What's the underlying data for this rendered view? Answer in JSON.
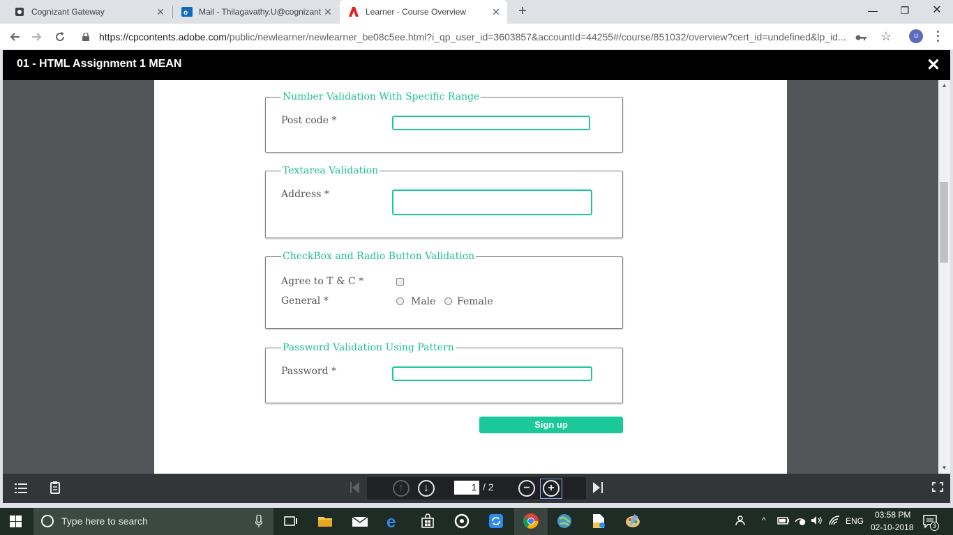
{
  "browser": {
    "tabs": [
      {
        "title": "Cognizant Gateway",
        "active": false,
        "icon": "gateway-icon"
      },
      {
        "title": "Mail - Thilagavathy.U@cognizant",
        "active": false,
        "icon": "outlook-icon"
      },
      {
        "title": "Learner - Course Overview",
        "active": true,
        "icon": "adobe-icon"
      }
    ],
    "tab_close": "✕",
    "new_tab": "+",
    "window_controls": {
      "minimize": "—",
      "restore": "❐",
      "close": "✕"
    },
    "url_host": "https://cpcontents.adobe.com",
    "url_rest": "/public/newlearner/newlearner_be08c5ee.html?i_qp_user_id=3603857&accountId=44255#/course/851032/overview?cert_id=undefined&lp_id...",
    "avatar_letter": "u"
  },
  "modal": {
    "title": "01 - HTML Assignment 1 MEAN",
    "close_glyph": "✕"
  },
  "form": {
    "number_section": {
      "legend": "Number Validation With Specific Range",
      "label": "Post code *",
      "value": ""
    },
    "textarea_section": {
      "legend": "Textarea Validation",
      "label": "Address *",
      "value": ""
    },
    "checkbox_section": {
      "legend": "CheckBox and Radio Button Validation",
      "agree_label": "Agree to T & C *",
      "agree_checked": false,
      "gender_label": "General *",
      "options": [
        "Male",
        "Female"
      ]
    },
    "password_section": {
      "legend": "Password Validation Using Pattern",
      "label": "Password *",
      "value": ""
    },
    "submit_label": "Sign up"
  },
  "viewer": {
    "current_page": "1",
    "page_total": "/ 2",
    "zoom_out": "−",
    "zoom_in": "+"
  },
  "taskbar": {
    "search_placeholder": "Type here to search",
    "language": "ENG",
    "time": "03:58 PM",
    "date": "02-10-2018",
    "notification_count": "3"
  },
  "colors": {
    "accent": "#1ac89a",
    "legend": "#1fbf97",
    "modal_header": "#000000",
    "viewer_bg": "#525659"
  }
}
